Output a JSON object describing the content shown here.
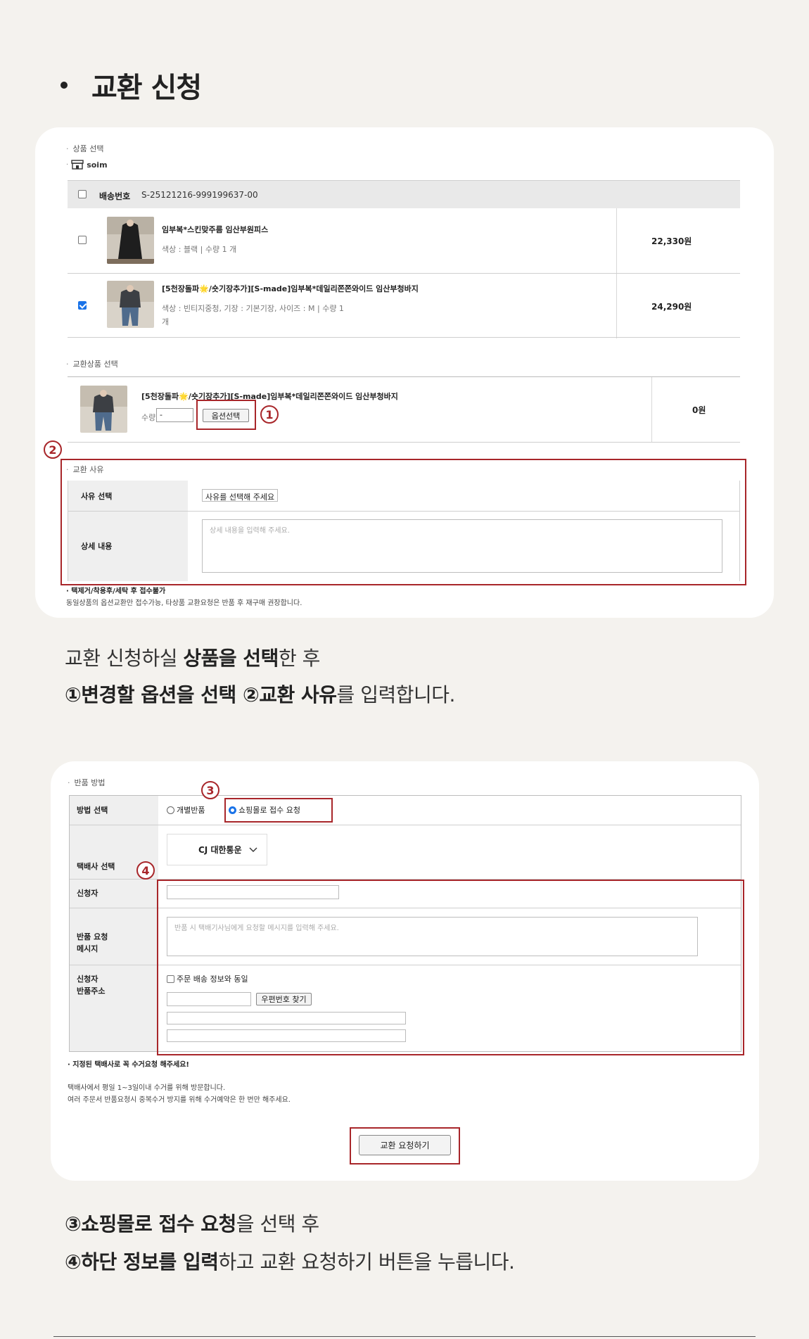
{
  "heading": "교환 신청",
  "card1": {
    "section_product": "상품 선택",
    "store_name": "soim",
    "delivery_label": "배송번호",
    "delivery_number": "S-25121216-999199637-00",
    "products": [
      {
        "name": "임부복*스킨맞주름 임산부원피스",
        "option": "색상 : 블랙  |  수량 1 개",
        "option2": "",
        "price": "22,330원",
        "checked": false
      },
      {
        "name": "[5천장돌파🌟/숏기장추가][S-made]임부복*데일리쫀쫀와이드 임산부청바지",
        "option": "색상 : 빈티지중청, 기장 : 기본기장, 사이즈 : M  |  수량 1",
        "option2": "개",
        "price": "24,290원",
        "checked": true
      }
    ],
    "section_exchange_product": "교환상품 선택",
    "exchange_product": {
      "name": "[5천장돌파🌟/숏기장추가][S-made]임부복*데일리쫀쫀와이드 임산부청바지",
      "qty_label": "수량",
      "qty_value": "-",
      "option_button": "옵션선택",
      "price": "0원"
    },
    "marker1": "1",
    "marker2": "2",
    "section_reason": "교환 사유",
    "reason_select_label": "사유 선택",
    "reason_select_value": "사유를 선택해 주세요",
    "detail_label": "상세 내용",
    "detail_placeholder": "상세 내용을 입력해 주세요.",
    "notice_title": "· 택제거/착용후/세탁 후 접수불가",
    "notice_text": "동일상품의 옵션교환만 접수가능, 타상품 교환요청은 반품 후 재구매 권장합니다."
  },
  "desc1": {
    "line1_a": "교환 신청하실 ",
    "line1_b": "상품을 선택",
    "line1_c": "한 후",
    "line2_a": "①변경할 옵션을 선택 ②교환 사유",
    "line2_b": "를 입력합니다."
  },
  "card2": {
    "section_method": "반품 방법",
    "method_label": "방법 선택",
    "option_individual": "개별반품",
    "option_mall": "쇼핑몰로 접수 요청",
    "courier_label": "택배사 선택",
    "courier_value": "CJ 대한통운",
    "applicant_label": "신청자",
    "message_label_1": "반품 요청",
    "message_label_2": "메시지",
    "message_placeholder": "반품 시 택배기사님에게 요청할 메시지를 입력해 주세요.",
    "address_label_1": "신청자",
    "address_label_2": "반품주소",
    "same_as_order": "주문 배송 정보와 동일",
    "zip_button": "우편번호 찾기",
    "marker3": "3",
    "marker4": "4",
    "notice_title": "· 지정된 택배사로 꼭 수거요청 해주세요!",
    "notice_line1": "택배사에서 평일 1~3일이내 수거를 위해 방문합니다.",
    "notice_line2": "여러 주문서 반품요청시 중복수거 방지를 위해 수거예약은 한 번만 해주세요.",
    "submit_button": "교환 요청하기"
  },
  "desc2": {
    "line1_a": "③쇼핑몰로 접수 요청",
    "line1_b": "을 선택 후",
    "line2_a": "④하단 정보를 입력",
    "line2_b": "하고 교환 요청하기 버튼을 누릅니다."
  }
}
